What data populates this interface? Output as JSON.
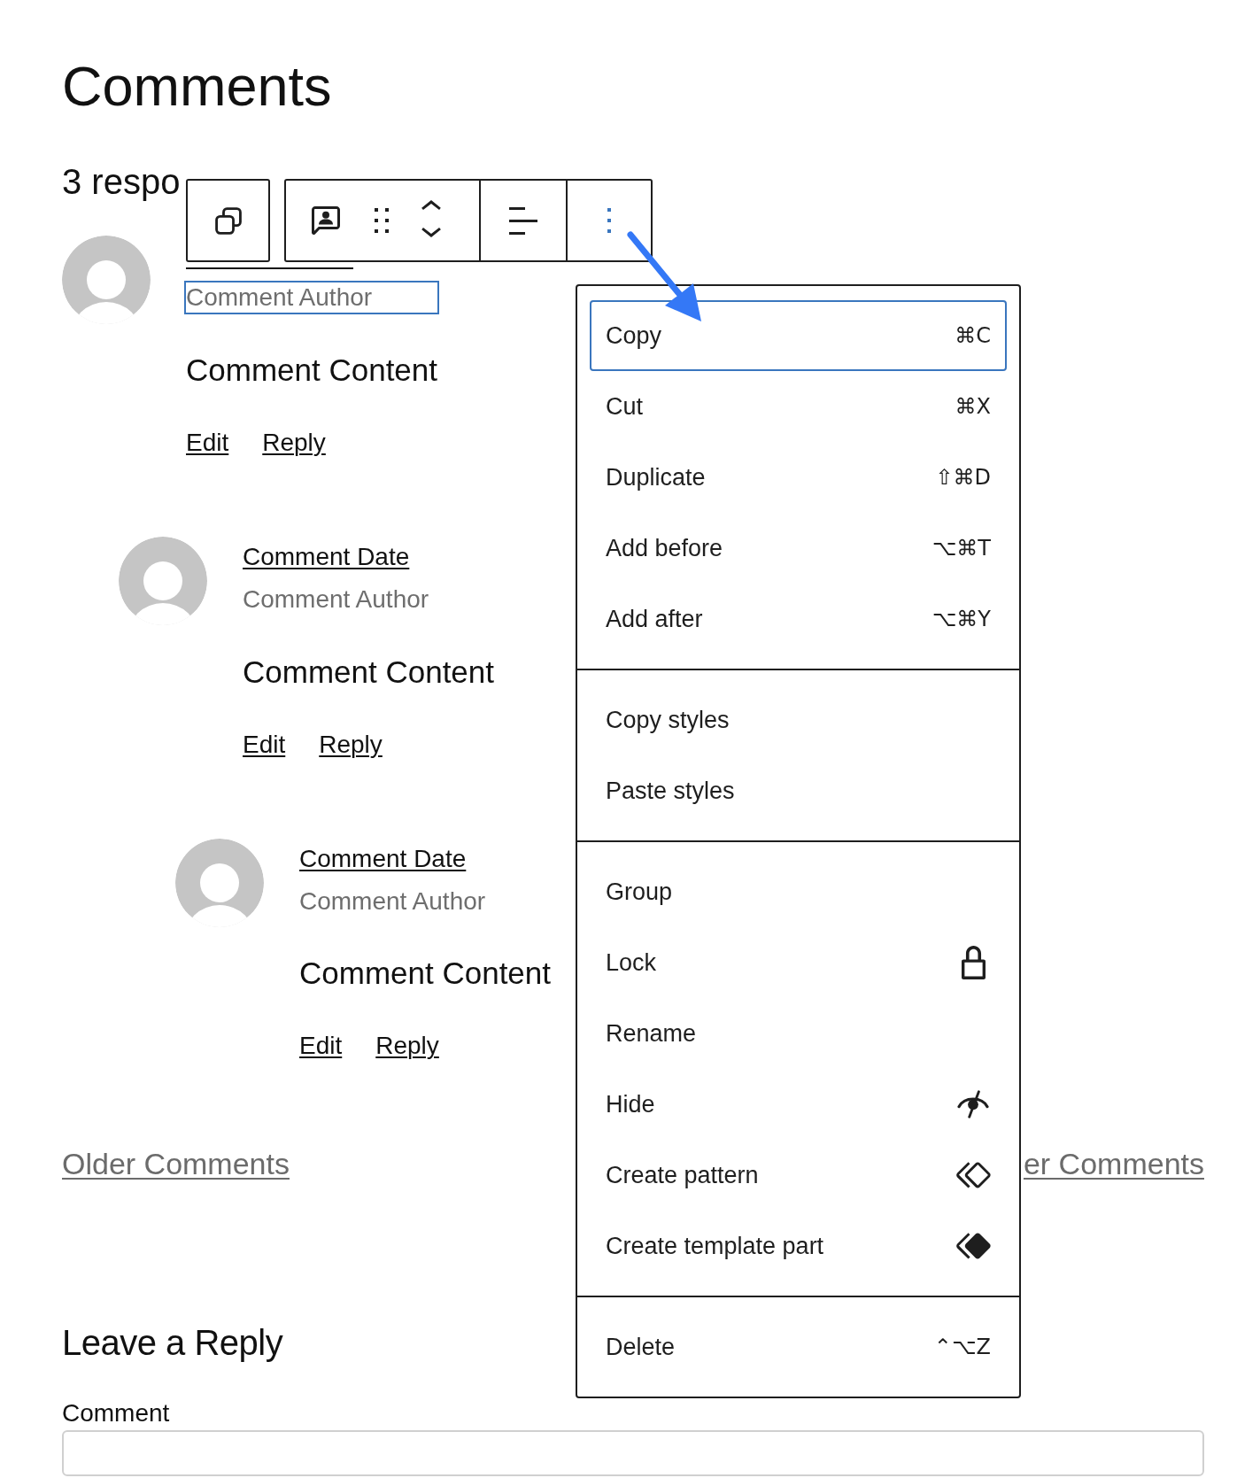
{
  "page": {
    "title": "Comments",
    "responses_heading": "3 respo"
  },
  "block_toolbar": {
    "more_pressed": true
  },
  "comments": [
    {
      "author": "Comment Author",
      "author_selected": true,
      "content": "Comment Content",
      "actions": [
        "Edit",
        "Reply"
      ],
      "children": [
        {
          "date": "Comment Date",
          "author": "Comment Author",
          "author_selected": false,
          "content": "Comment Content",
          "actions": [
            "Edit",
            "Reply"
          ],
          "children": [
            {
              "date": "Comment Date",
              "author": "Comment Author",
              "author_selected": false,
              "content": "Comment Content",
              "actions": [
                "Edit",
                "Reply"
              ]
            }
          ]
        }
      ]
    }
  ],
  "menu": {
    "sections": [
      {
        "items": [
          {
            "label": "Copy",
            "kind": "command",
            "shortcut": "⌘C",
            "selected": true
          },
          {
            "label": "Cut",
            "kind": "command",
            "shortcut": "⌘X",
            "selected": false
          },
          {
            "label": "Duplicate",
            "kind": "command",
            "shortcut": "⇧⌘D",
            "selected": false
          },
          {
            "label": "Add before",
            "kind": "command",
            "shortcut": "⌥⌘T",
            "selected": false
          },
          {
            "label": "Add after",
            "kind": "command",
            "shortcut": "⌥⌘Y",
            "selected": false
          }
        ]
      },
      {
        "items": [
          {
            "label": "Copy styles",
            "kind": "command",
            "selected": false
          },
          {
            "label": "Paste styles",
            "kind": "command",
            "selected": false
          }
        ]
      },
      {
        "items": [
          {
            "label": "Group",
            "kind": "command",
            "selected": false
          },
          {
            "label": "Lock",
            "kind": "lock",
            "selected": false
          },
          {
            "label": "Rename",
            "kind": "command",
            "selected": false
          },
          {
            "label": "Hide",
            "kind": "hide",
            "selected": false
          },
          {
            "label": "Create pattern",
            "kind": "pattern",
            "selected": false
          },
          {
            "label": "Create template part",
            "kind": "part",
            "selected": false
          }
        ]
      },
      {
        "items": [
          {
            "label": "Delete",
            "kind": "command",
            "shortcut": "⌃⌥Z",
            "selected": false
          }
        ]
      }
    ]
  },
  "pagination": {
    "previous": "Older Comments",
    "next": "er Comments"
  },
  "reply_form": {
    "title": "Leave a Reply",
    "comment_label": "Comment"
  }
}
